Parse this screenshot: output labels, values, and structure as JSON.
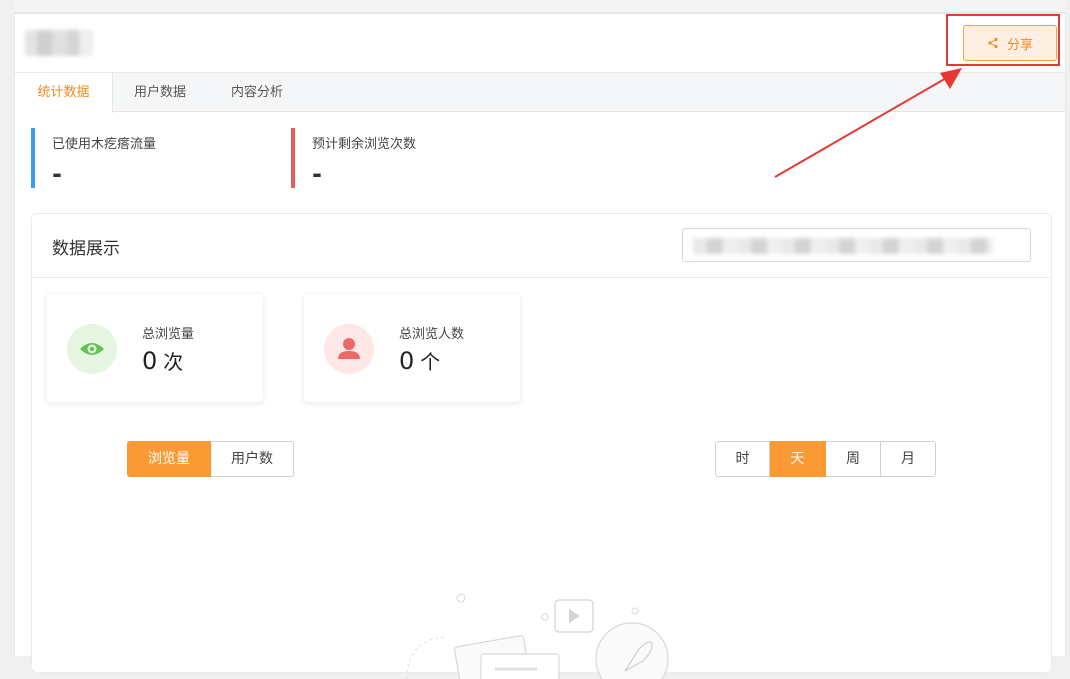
{
  "header": {
    "share_label": "分享",
    "share_icon": "share-icon"
  },
  "tabs": [
    {
      "label": "统计数据",
      "active": true
    },
    {
      "label": "用户数据",
      "active": false
    },
    {
      "label": "内容分析",
      "active": false
    }
  ],
  "stats": [
    {
      "label": "已使用木疙瘩流量",
      "value": "-",
      "color": "#3d9af7"
    },
    {
      "label": "预计剩余浏览次数",
      "value": "-",
      "color": "#ea5b5b"
    }
  ],
  "panel": {
    "title": "数据展示",
    "cards": [
      {
        "label": "总浏览量",
        "value": "0",
        "unit": "次",
        "icon": "eye-icon",
        "color": "#63c155",
        "bg": "#e5f5e1"
      },
      {
        "label": "总浏览人数",
        "value": "0",
        "unit": "个",
        "icon": "user-icon",
        "color": "#ee6868",
        "bg": "#fde7e7"
      }
    ],
    "metric_toggle": [
      {
        "label": "浏览量",
        "active": true
      },
      {
        "label": "用户数",
        "active": false
      }
    ],
    "period_toggle": [
      {
        "label": "时",
        "active": false
      },
      {
        "label": "天",
        "active": true
      },
      {
        "label": "周",
        "active": false
      },
      {
        "label": "月",
        "active": false
      }
    ]
  },
  "colors": {
    "accent": "#f08a24",
    "toggle_active": "#fa9a34",
    "highlight": "#e53935"
  }
}
